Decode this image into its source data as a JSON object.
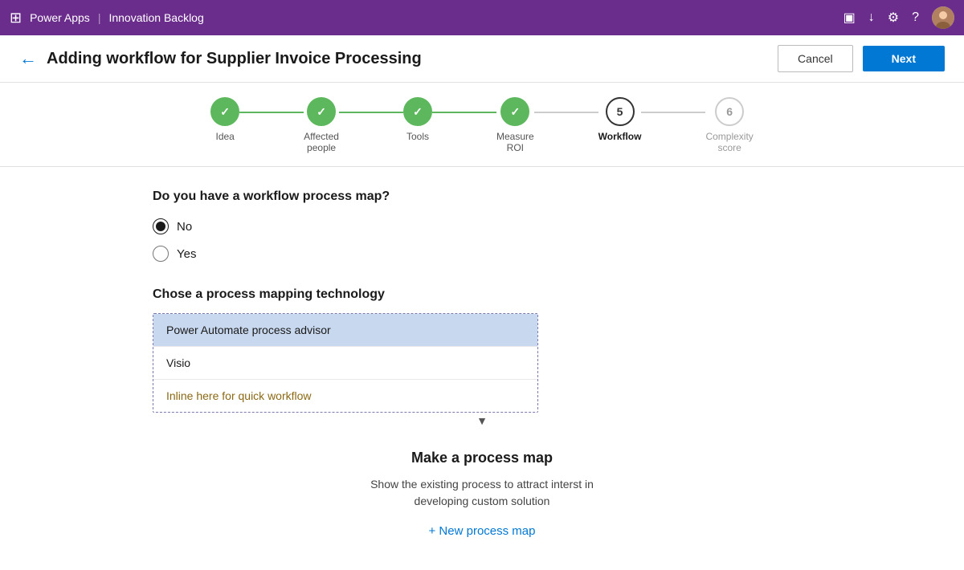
{
  "topbar": {
    "app_name": "Power Apps",
    "separator": "|",
    "module_name": "Innovation Backlog",
    "icons": [
      "monitor-icon",
      "download-icon",
      "settings-icon",
      "help-icon"
    ]
  },
  "header": {
    "title": "Adding workflow for Supplier Invoice Processing",
    "cancel_label": "Cancel",
    "next_label": "Next"
  },
  "stepper": {
    "steps": [
      {
        "id": "idea",
        "label": "Idea",
        "state": "done",
        "number": ""
      },
      {
        "id": "affected-people",
        "label": "Affected people",
        "state": "done",
        "number": ""
      },
      {
        "id": "tools",
        "label": "Tools",
        "state": "done",
        "number": ""
      },
      {
        "id": "measure-roi",
        "label": "Measure ROI",
        "state": "done",
        "number": ""
      },
      {
        "id": "workflow",
        "label": "Workflow",
        "state": "active",
        "number": "5"
      },
      {
        "id": "complexity-score",
        "label": "Complexity score",
        "state": "inactive",
        "number": "6"
      }
    ]
  },
  "form": {
    "question": "Do you have a workflow process map?",
    "radio_options": [
      {
        "value": "no",
        "label": "No",
        "checked": true
      },
      {
        "value": "yes",
        "label": "Yes",
        "checked": false
      }
    ],
    "process_mapping_title": "Chose a process mapping technology",
    "dropdown_options": [
      {
        "value": "power-automate",
        "label": "Power Automate process advisor",
        "selected": true
      },
      {
        "value": "visio",
        "label": "Visio",
        "selected": false
      },
      {
        "value": "inline",
        "label": "Inline here for quick workflow",
        "selected": false,
        "is_link": true
      }
    ],
    "make_process_title": "Make a process map",
    "make_process_desc": "Show the existing process to attract interst in\ndeveloping custom solution",
    "new_process_label": "+ New process map"
  }
}
